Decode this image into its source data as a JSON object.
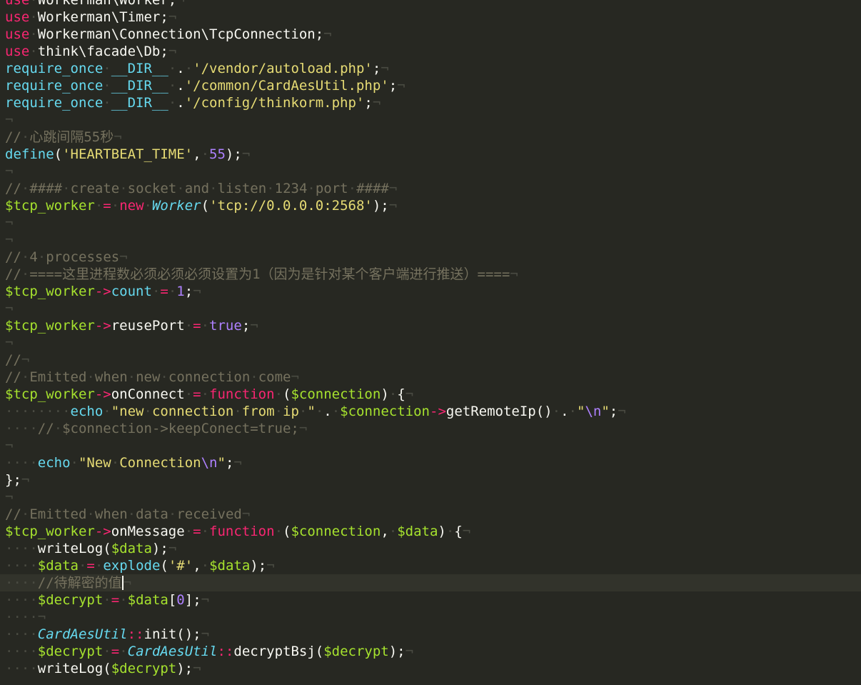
{
  "editor": {
    "theme": {
      "background": "#272822",
      "current_line": "#32332b"
    },
    "current_line_index": 34,
    "lines": [
      [
        [
          "kw",
          "use"
        ],
        [
          "ws",
          "·"
        ],
        [
          "plain",
          "Workerman\\Worker;"
        ],
        [
          "eol",
          "¬"
        ]
      ],
      [
        [
          "kw",
          "use"
        ],
        [
          "ws",
          "·"
        ],
        [
          "plain",
          "Workerman\\Timer;"
        ],
        [
          "eol",
          "¬"
        ]
      ],
      [
        [
          "kw",
          "use"
        ],
        [
          "ws",
          "·"
        ],
        [
          "plain",
          "Workerman\\Connection\\TcpConnection;"
        ],
        [
          "eol",
          "¬"
        ]
      ],
      [
        [
          "kw",
          "use"
        ],
        [
          "ws",
          "·"
        ],
        [
          "plain",
          "think\\facade\\Db;"
        ],
        [
          "eol",
          "¬"
        ]
      ],
      [
        [
          "fn",
          "require_once"
        ],
        [
          "ws",
          "·"
        ],
        [
          "fn",
          "__DIR__"
        ],
        [
          "ws",
          "·"
        ],
        [
          "plain",
          "."
        ],
        [
          "ws",
          "·"
        ],
        [
          "str",
          "'/vendor/autoload.php'"
        ],
        [
          "plain",
          ";"
        ],
        [
          "eol",
          "¬"
        ]
      ],
      [
        [
          "fn",
          "require_once"
        ],
        [
          "ws",
          "·"
        ],
        [
          "fn",
          "__DIR__"
        ],
        [
          "ws",
          "·"
        ],
        [
          "plain",
          "."
        ],
        [
          "str",
          "'/common/CardAesUtil.php'"
        ],
        [
          "plain",
          ";"
        ],
        [
          "eol",
          "¬"
        ]
      ],
      [
        [
          "fn",
          "require_once"
        ],
        [
          "ws",
          "·"
        ],
        [
          "fn",
          "__DIR__"
        ],
        [
          "ws",
          "·"
        ],
        [
          "plain",
          "."
        ],
        [
          "str",
          "'/config/thinkorm.php'"
        ],
        [
          "plain",
          ";"
        ],
        [
          "eol",
          "¬"
        ]
      ],
      [
        [
          "eol",
          "¬"
        ]
      ],
      [
        [
          "cmt",
          "//"
        ],
        [
          "ws",
          "·"
        ],
        [
          "cmt",
          "心跳间隔55秒"
        ],
        [
          "eol",
          "¬"
        ]
      ],
      [
        [
          "fn",
          "define"
        ],
        [
          "plain",
          "("
        ],
        [
          "str",
          "'HEARTBEAT_TIME'"
        ],
        [
          "plain",
          ","
        ],
        [
          "ws",
          "·"
        ],
        [
          "num",
          "55"
        ],
        [
          "plain",
          ");"
        ],
        [
          "eol",
          "¬"
        ]
      ],
      [
        [
          "eol",
          "¬"
        ]
      ],
      [
        [
          "cmt",
          "//"
        ],
        [
          "ws",
          "·"
        ],
        [
          "cmt",
          "####"
        ],
        [
          "ws",
          "·"
        ],
        [
          "cmt",
          "create"
        ],
        [
          "ws",
          "·"
        ],
        [
          "cmt",
          "socket"
        ],
        [
          "ws",
          "·"
        ],
        [
          "cmt",
          "and"
        ],
        [
          "ws",
          "·"
        ],
        [
          "cmt",
          "listen"
        ],
        [
          "ws",
          "·"
        ],
        [
          "cmt",
          "1234"
        ],
        [
          "ws",
          "·"
        ],
        [
          "cmt",
          "port"
        ],
        [
          "ws",
          "·"
        ],
        [
          "cmt",
          "####"
        ],
        [
          "eol",
          "¬"
        ]
      ],
      [
        [
          "var",
          "$tcp_worker"
        ],
        [
          "ws",
          "·"
        ],
        [
          "op",
          "="
        ],
        [
          "ws",
          "·"
        ],
        [
          "kw",
          "new"
        ],
        [
          "ws",
          "·"
        ],
        [
          "cls",
          "Worker"
        ],
        [
          "plain",
          "("
        ],
        [
          "str",
          "'tcp://0.0.0.0:2568'"
        ],
        [
          "plain",
          ");"
        ],
        [
          "eol",
          "¬"
        ]
      ],
      [
        [
          "eol",
          "¬"
        ]
      ],
      [
        [
          "eol",
          "¬"
        ]
      ],
      [
        [
          "cmt",
          "//"
        ],
        [
          "ws",
          "·"
        ],
        [
          "cmt",
          "4"
        ],
        [
          "ws",
          "·"
        ],
        [
          "cmt",
          "processes"
        ],
        [
          "eol",
          "¬"
        ]
      ],
      [
        [
          "cmt",
          "//"
        ],
        [
          "ws",
          "·"
        ],
        [
          "cmt",
          "====这里进程数必须必须必须设置为1（因为是针对某个客户端进行推送）===="
        ],
        [
          "eol",
          "¬"
        ]
      ],
      [
        [
          "var",
          "$tcp_worker"
        ],
        [
          "op",
          "->"
        ],
        [
          "fn",
          "count"
        ],
        [
          "ws",
          "·"
        ],
        [
          "op",
          "="
        ],
        [
          "ws",
          "·"
        ],
        [
          "num",
          "1"
        ],
        [
          "plain",
          ";"
        ],
        [
          "eol",
          "¬"
        ]
      ],
      [
        [
          "eol",
          "¬"
        ]
      ],
      [
        [
          "var",
          "$tcp_worker"
        ],
        [
          "op",
          "->"
        ],
        [
          "plain",
          "reusePort"
        ],
        [
          "ws",
          "·"
        ],
        [
          "op",
          "="
        ],
        [
          "ws",
          "·"
        ],
        [
          "num",
          "true"
        ],
        [
          "plain",
          ";"
        ],
        [
          "eol",
          "¬"
        ]
      ],
      [
        [
          "eol",
          "¬"
        ]
      ],
      [
        [
          "cmt",
          "//"
        ],
        [
          "eol",
          "¬"
        ]
      ],
      [
        [
          "cmt",
          "//"
        ],
        [
          "ws",
          "·"
        ],
        [
          "cmt",
          "Emitted"
        ],
        [
          "ws",
          "·"
        ],
        [
          "cmt",
          "when"
        ],
        [
          "ws",
          "·"
        ],
        [
          "cmt",
          "new"
        ],
        [
          "ws",
          "·"
        ],
        [
          "cmt",
          "connection"
        ],
        [
          "ws",
          "·"
        ],
        [
          "cmt",
          "come"
        ],
        [
          "eol",
          "¬"
        ]
      ],
      [
        [
          "var",
          "$tcp_worker"
        ],
        [
          "op",
          "->"
        ],
        [
          "plain",
          "onConnect"
        ],
        [
          "ws",
          "·"
        ],
        [
          "op",
          "="
        ],
        [
          "ws",
          "·"
        ],
        [
          "kw",
          "function"
        ],
        [
          "ws",
          "·"
        ],
        [
          "plain",
          "("
        ],
        [
          "var",
          "$connection"
        ],
        [
          "plain",
          ")"
        ],
        [
          "ws",
          "·"
        ],
        [
          "plain",
          "{"
        ],
        [
          "eol",
          "¬"
        ]
      ],
      [
        [
          "ws",
          "········"
        ],
        [
          "fn",
          "echo"
        ],
        [
          "ws",
          "·"
        ],
        [
          "str",
          "\"new"
        ],
        [
          "ws",
          "·"
        ],
        [
          "str",
          "connection"
        ],
        [
          "ws",
          "·"
        ],
        [
          "str",
          "from"
        ],
        [
          "ws",
          "·"
        ],
        [
          "str",
          "ip"
        ],
        [
          "ws",
          "·"
        ],
        [
          "str",
          "\""
        ],
        [
          "ws",
          "·"
        ],
        [
          "plain",
          "."
        ],
        [
          "ws",
          "·"
        ],
        [
          "var",
          "$connection"
        ],
        [
          "op",
          "->"
        ],
        [
          "plain",
          "getRemoteIp()"
        ],
        [
          "ws",
          "·"
        ],
        [
          "plain",
          "."
        ],
        [
          "ws",
          "·"
        ],
        [
          "str",
          "\""
        ],
        [
          "num",
          "\\n"
        ],
        [
          "str",
          "\""
        ],
        [
          "plain",
          ";"
        ],
        [
          "eol",
          "¬"
        ]
      ],
      [
        [
          "ws",
          "····"
        ],
        [
          "cmt",
          "//"
        ],
        [
          "ws",
          "·"
        ],
        [
          "cmt",
          "$connection->keepConect=true;"
        ],
        [
          "eol",
          "¬"
        ]
      ],
      [
        [
          "eol",
          "¬"
        ]
      ],
      [
        [
          "ws",
          "····"
        ],
        [
          "fn",
          "echo"
        ],
        [
          "ws",
          "·"
        ],
        [
          "str",
          "\"New"
        ],
        [
          "ws",
          "·"
        ],
        [
          "str",
          "Connection"
        ],
        [
          "num",
          "\\n"
        ],
        [
          "str",
          "\""
        ],
        [
          "plain",
          ";"
        ],
        [
          "eol",
          "¬"
        ]
      ],
      [
        [
          "plain",
          "};"
        ],
        [
          "eol",
          "¬"
        ]
      ],
      [
        [
          "eol",
          "¬"
        ]
      ],
      [
        [
          "cmt",
          "//"
        ],
        [
          "ws",
          "·"
        ],
        [
          "cmt",
          "Emitted"
        ],
        [
          "ws",
          "·"
        ],
        [
          "cmt",
          "when"
        ],
        [
          "ws",
          "·"
        ],
        [
          "cmt",
          "data"
        ],
        [
          "ws",
          "·"
        ],
        [
          "cmt",
          "received"
        ],
        [
          "eol",
          "¬"
        ]
      ],
      [
        [
          "var",
          "$tcp_worker"
        ],
        [
          "op",
          "->"
        ],
        [
          "plain",
          "onMessage"
        ],
        [
          "ws",
          "·"
        ],
        [
          "op",
          "="
        ],
        [
          "ws",
          "·"
        ],
        [
          "kw",
          "function"
        ],
        [
          "ws",
          "·"
        ],
        [
          "plain",
          "("
        ],
        [
          "var",
          "$connection"
        ],
        [
          "plain",
          ","
        ],
        [
          "ws",
          "·"
        ],
        [
          "var",
          "$data"
        ],
        [
          "plain",
          ")"
        ],
        [
          "ws",
          "·"
        ],
        [
          "plain",
          "{"
        ],
        [
          "eol",
          "¬"
        ]
      ],
      [
        [
          "ws",
          "····"
        ],
        [
          "plain",
          "writeLog("
        ],
        [
          "var",
          "$data"
        ],
        [
          "plain",
          ");"
        ],
        [
          "eol",
          "¬"
        ]
      ],
      [
        [
          "ws",
          "····"
        ],
        [
          "var",
          "$data"
        ],
        [
          "ws",
          "·"
        ],
        [
          "op",
          "="
        ],
        [
          "ws",
          "·"
        ],
        [
          "fn",
          "explode"
        ],
        [
          "plain",
          "("
        ],
        [
          "str",
          "'#'"
        ],
        [
          "plain",
          ","
        ],
        [
          "ws",
          "·"
        ],
        [
          "var",
          "$data"
        ],
        [
          "plain",
          ");"
        ],
        [
          "eol",
          "¬"
        ]
      ],
      [
        [
          "ws",
          "····"
        ],
        [
          "cmt",
          "//待解密的值"
        ],
        [
          "cursor",
          ""
        ],
        [
          "eol",
          "¬"
        ]
      ],
      [
        [
          "ws",
          "····"
        ],
        [
          "var",
          "$decrypt"
        ],
        [
          "ws",
          "·"
        ],
        [
          "op",
          "="
        ],
        [
          "ws",
          "·"
        ],
        [
          "var",
          "$data"
        ],
        [
          "plain",
          "["
        ],
        [
          "num",
          "0"
        ],
        [
          "plain",
          "];"
        ],
        [
          "eol",
          "¬"
        ]
      ],
      [
        [
          "ws",
          "····"
        ],
        [
          "eol",
          "¬"
        ]
      ],
      [
        [
          "ws",
          "····"
        ],
        [
          "cls",
          "CardAesUtil"
        ],
        [
          "op",
          "::"
        ],
        [
          "plain",
          "init();"
        ],
        [
          "eol",
          "¬"
        ]
      ],
      [
        [
          "ws",
          "····"
        ],
        [
          "var",
          "$decrypt"
        ],
        [
          "ws",
          "·"
        ],
        [
          "op",
          "="
        ],
        [
          "ws",
          "·"
        ],
        [
          "cls",
          "CardAesUtil"
        ],
        [
          "op",
          "::"
        ],
        [
          "plain",
          "decryptBsj("
        ],
        [
          "var",
          "$decrypt"
        ],
        [
          "plain",
          ");"
        ],
        [
          "eol",
          "¬"
        ]
      ],
      [
        [
          "ws",
          "····"
        ],
        [
          "plain",
          "writeLog("
        ],
        [
          "var",
          "$decrypt"
        ],
        [
          "plain",
          ");"
        ],
        [
          "eol",
          "¬"
        ]
      ]
    ]
  }
}
